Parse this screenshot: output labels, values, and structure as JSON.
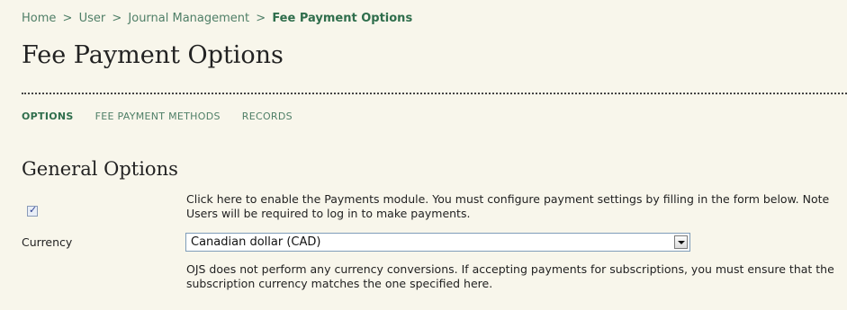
{
  "breadcrumb": {
    "items": [
      "Home",
      "User",
      "Journal Management"
    ],
    "separator": ">",
    "current": "Fee Payment Options"
  },
  "page_title": "Fee Payment Options",
  "tabs": [
    {
      "label": "Options",
      "active": true
    },
    {
      "label": "Fee Payment Methods",
      "active": false
    },
    {
      "label": "Records",
      "active": false
    }
  ],
  "general_options": {
    "title": "General Options",
    "enable_checkbox": {
      "checked": true,
      "label": "Click here to enable the Payments module. You must configure payment settings by filling in the form below. Note Users will be required to log in to make payments."
    },
    "currency": {
      "label": "Currency",
      "selected": "Canadian dollar (CAD)",
      "note": "OJS does not perform any currency conversions. If accepting payments for subscriptions, you must ensure that the subscription currency matches the one specified here."
    }
  },
  "colors": {
    "background": "#f8f6eb",
    "link_green": "#4f7f67",
    "active_green": "#2f6e4c"
  },
  "icons": {
    "checkbox_mark": "✓",
    "dropdown": "chevron-down-icon"
  }
}
